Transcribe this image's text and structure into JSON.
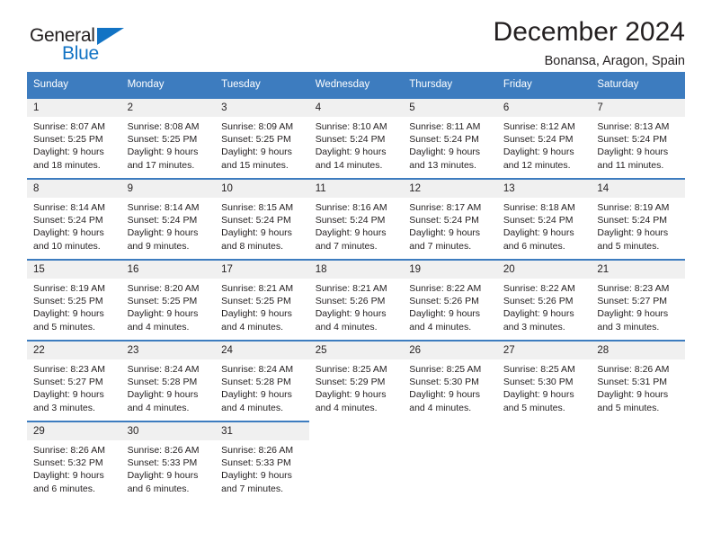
{
  "brand": {
    "name_part1": "General",
    "name_part2": "Blue",
    "logo_icon": "triangle-icon",
    "accent_color": "#1273c4"
  },
  "header": {
    "title": "December 2024",
    "subtitle": "Bonansa, Aragon, Spain"
  },
  "calendar": {
    "header_color": "#3d7cbf",
    "weekday_headers": [
      "Sunday",
      "Monday",
      "Tuesday",
      "Wednesday",
      "Thursday",
      "Friday",
      "Saturday"
    ],
    "weeks": [
      [
        {
          "day": "1",
          "sunrise": "Sunrise: 8:07 AM",
          "sunset": "Sunset: 5:25 PM",
          "daylight_1": "Daylight: 9 hours",
          "daylight_2": "and 18 minutes."
        },
        {
          "day": "2",
          "sunrise": "Sunrise: 8:08 AM",
          "sunset": "Sunset: 5:25 PM",
          "daylight_1": "Daylight: 9 hours",
          "daylight_2": "and 17 minutes."
        },
        {
          "day": "3",
          "sunrise": "Sunrise: 8:09 AM",
          "sunset": "Sunset: 5:25 PM",
          "daylight_1": "Daylight: 9 hours",
          "daylight_2": "and 15 minutes."
        },
        {
          "day": "4",
          "sunrise": "Sunrise: 8:10 AM",
          "sunset": "Sunset: 5:24 PM",
          "daylight_1": "Daylight: 9 hours",
          "daylight_2": "and 14 minutes."
        },
        {
          "day": "5",
          "sunrise": "Sunrise: 8:11 AM",
          "sunset": "Sunset: 5:24 PM",
          "daylight_1": "Daylight: 9 hours",
          "daylight_2": "and 13 minutes."
        },
        {
          "day": "6",
          "sunrise": "Sunrise: 8:12 AM",
          "sunset": "Sunset: 5:24 PM",
          "daylight_1": "Daylight: 9 hours",
          "daylight_2": "and 12 minutes."
        },
        {
          "day": "7",
          "sunrise": "Sunrise: 8:13 AM",
          "sunset": "Sunset: 5:24 PM",
          "daylight_1": "Daylight: 9 hours",
          "daylight_2": "and 11 minutes."
        }
      ],
      [
        {
          "day": "8",
          "sunrise": "Sunrise: 8:14 AM",
          "sunset": "Sunset: 5:24 PM",
          "daylight_1": "Daylight: 9 hours",
          "daylight_2": "and 10 minutes."
        },
        {
          "day": "9",
          "sunrise": "Sunrise: 8:14 AM",
          "sunset": "Sunset: 5:24 PM",
          "daylight_1": "Daylight: 9 hours",
          "daylight_2": "and 9 minutes."
        },
        {
          "day": "10",
          "sunrise": "Sunrise: 8:15 AM",
          "sunset": "Sunset: 5:24 PM",
          "daylight_1": "Daylight: 9 hours",
          "daylight_2": "and 8 minutes."
        },
        {
          "day": "11",
          "sunrise": "Sunrise: 8:16 AM",
          "sunset": "Sunset: 5:24 PM",
          "daylight_1": "Daylight: 9 hours",
          "daylight_2": "and 7 minutes."
        },
        {
          "day": "12",
          "sunrise": "Sunrise: 8:17 AM",
          "sunset": "Sunset: 5:24 PM",
          "daylight_1": "Daylight: 9 hours",
          "daylight_2": "and 7 minutes."
        },
        {
          "day": "13",
          "sunrise": "Sunrise: 8:18 AM",
          "sunset": "Sunset: 5:24 PM",
          "daylight_1": "Daylight: 9 hours",
          "daylight_2": "and 6 minutes."
        },
        {
          "day": "14",
          "sunrise": "Sunrise: 8:19 AM",
          "sunset": "Sunset: 5:24 PM",
          "daylight_1": "Daylight: 9 hours",
          "daylight_2": "and 5 minutes."
        }
      ],
      [
        {
          "day": "15",
          "sunrise": "Sunrise: 8:19 AM",
          "sunset": "Sunset: 5:25 PM",
          "daylight_1": "Daylight: 9 hours",
          "daylight_2": "and 5 minutes."
        },
        {
          "day": "16",
          "sunrise": "Sunrise: 8:20 AM",
          "sunset": "Sunset: 5:25 PM",
          "daylight_1": "Daylight: 9 hours",
          "daylight_2": "and 4 minutes."
        },
        {
          "day": "17",
          "sunrise": "Sunrise: 8:21 AM",
          "sunset": "Sunset: 5:25 PM",
          "daylight_1": "Daylight: 9 hours",
          "daylight_2": "and 4 minutes."
        },
        {
          "day": "18",
          "sunrise": "Sunrise: 8:21 AM",
          "sunset": "Sunset: 5:26 PM",
          "daylight_1": "Daylight: 9 hours",
          "daylight_2": "and 4 minutes."
        },
        {
          "day": "19",
          "sunrise": "Sunrise: 8:22 AM",
          "sunset": "Sunset: 5:26 PM",
          "daylight_1": "Daylight: 9 hours",
          "daylight_2": "and 4 minutes."
        },
        {
          "day": "20",
          "sunrise": "Sunrise: 8:22 AM",
          "sunset": "Sunset: 5:26 PM",
          "daylight_1": "Daylight: 9 hours",
          "daylight_2": "and 3 minutes."
        },
        {
          "day": "21",
          "sunrise": "Sunrise: 8:23 AM",
          "sunset": "Sunset: 5:27 PM",
          "daylight_1": "Daylight: 9 hours",
          "daylight_2": "and 3 minutes."
        }
      ],
      [
        {
          "day": "22",
          "sunrise": "Sunrise: 8:23 AM",
          "sunset": "Sunset: 5:27 PM",
          "daylight_1": "Daylight: 9 hours",
          "daylight_2": "and 3 minutes."
        },
        {
          "day": "23",
          "sunrise": "Sunrise: 8:24 AM",
          "sunset": "Sunset: 5:28 PM",
          "daylight_1": "Daylight: 9 hours",
          "daylight_2": "and 4 minutes."
        },
        {
          "day": "24",
          "sunrise": "Sunrise: 8:24 AM",
          "sunset": "Sunset: 5:28 PM",
          "daylight_1": "Daylight: 9 hours",
          "daylight_2": "and 4 minutes."
        },
        {
          "day": "25",
          "sunrise": "Sunrise: 8:25 AM",
          "sunset": "Sunset: 5:29 PM",
          "daylight_1": "Daylight: 9 hours",
          "daylight_2": "and 4 minutes."
        },
        {
          "day": "26",
          "sunrise": "Sunrise: 8:25 AM",
          "sunset": "Sunset: 5:30 PM",
          "daylight_1": "Daylight: 9 hours",
          "daylight_2": "and 4 minutes."
        },
        {
          "day": "27",
          "sunrise": "Sunrise: 8:25 AM",
          "sunset": "Sunset: 5:30 PM",
          "daylight_1": "Daylight: 9 hours",
          "daylight_2": "and 5 minutes."
        },
        {
          "day": "28",
          "sunrise": "Sunrise: 8:26 AM",
          "sunset": "Sunset: 5:31 PM",
          "daylight_1": "Daylight: 9 hours",
          "daylight_2": "and 5 minutes."
        }
      ],
      [
        {
          "day": "29",
          "sunrise": "Sunrise: 8:26 AM",
          "sunset": "Sunset: 5:32 PM",
          "daylight_1": "Daylight: 9 hours",
          "daylight_2": "and 6 minutes."
        },
        {
          "day": "30",
          "sunrise": "Sunrise: 8:26 AM",
          "sunset": "Sunset: 5:33 PM",
          "daylight_1": "Daylight: 9 hours",
          "daylight_2": "and 6 minutes."
        },
        {
          "day": "31",
          "sunrise": "Sunrise: 8:26 AM",
          "sunset": "Sunset: 5:33 PM",
          "daylight_1": "Daylight: 9 hours",
          "daylight_2": "and 7 minutes."
        },
        {
          "day": "",
          "sunrise": "",
          "sunset": "",
          "daylight_1": "",
          "daylight_2": ""
        },
        {
          "day": "",
          "sunrise": "",
          "sunset": "",
          "daylight_1": "",
          "daylight_2": ""
        },
        {
          "day": "",
          "sunrise": "",
          "sunset": "",
          "daylight_1": "",
          "daylight_2": ""
        },
        {
          "day": "",
          "sunrise": "",
          "sunset": "",
          "daylight_1": "",
          "daylight_2": ""
        }
      ]
    ]
  }
}
